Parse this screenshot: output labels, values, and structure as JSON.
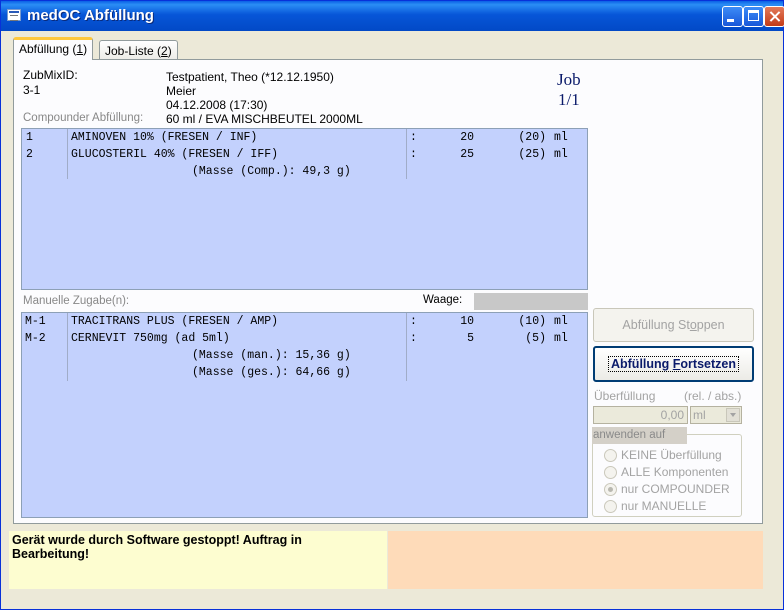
{
  "window": {
    "title": "medOC Abfüllung"
  },
  "tabs": [
    {
      "label_pre": "Abfüllung (",
      "label_key": "1",
      "label_post": ")"
    },
    {
      "label_pre": "Job-Liste (",
      "label_key": "2",
      "label_post": ")"
    }
  ],
  "patient": {
    "zubmix_label": "ZubMixID:",
    "zubmix_id": "3-1",
    "name": "Testpatient, Theo (*12.12.1950)",
    "doctor": "Meier",
    "date": "04.12.2008 (17:30)",
    "compounder_label": "Compounder Abfüllung:",
    "bag": "60 ml / EVA MISCHBEUTEL 2000ML"
  },
  "job": {
    "label": "Job",
    "progress": "1/1"
  },
  "compounder_list": {
    "rows": [
      {
        "idx": "1",
        "name": "AMINOVEN 10% (FRESEN / INF)",
        "colon": ":",
        "amount": "20",
        "total": "(20)",
        "unit": "ml"
      },
      {
        "idx": "2",
        "name": "GLUCOSTERIL 40%  (FRESEN / IFF)",
        "colon": ":",
        "amount": "25",
        "total": "(25)",
        "unit": "ml"
      }
    ],
    "mass": "(Masse (Comp.): 49,3 g)"
  },
  "manual": {
    "label": "Manuelle Zugabe(n):",
    "waage_label": "Waage:",
    "rows": [
      {
        "idx": "M-1",
        "name": "TRACITRANS PLUS (FRESEN / AMP)",
        "colon": ":",
        "amount": "10",
        "total": "(10)",
        "unit": "ml"
      },
      {
        "idx": "M-2",
        "name": "CERNEVIT 750mg (ad 5ml)",
        "colon": ":",
        "amount": "5",
        "total": "(5)",
        "unit": "ml"
      }
    ],
    "mass_man": "(Masse (man.): 15,36 g)",
    "mass_ges": "(Masse (ges.): 64,66 g)"
  },
  "buttons": {
    "stop_pre": "Abfüllung St",
    "stop_key": "o",
    "stop_post": "ppen",
    "continue_pre": "Abfüllung ",
    "continue_key": "F",
    "continue_post": "ortsetzen"
  },
  "overfill": {
    "label": "Überfüllung",
    "rel_abs": "(rel. / abs.)",
    "value": "0,00",
    "unit": "ml",
    "apply_label": "anwenden auf",
    "options": [
      "KEINE Überfüllung",
      "ALLE Komponenten",
      "nur COMPOUNDER",
      "nur MANUELLE"
    ],
    "selected": "nur COMPOUNDER"
  },
  "status": {
    "message": "Gerät wurde durch Software gestoppt! Auftrag in Bearbeitung!"
  }
}
